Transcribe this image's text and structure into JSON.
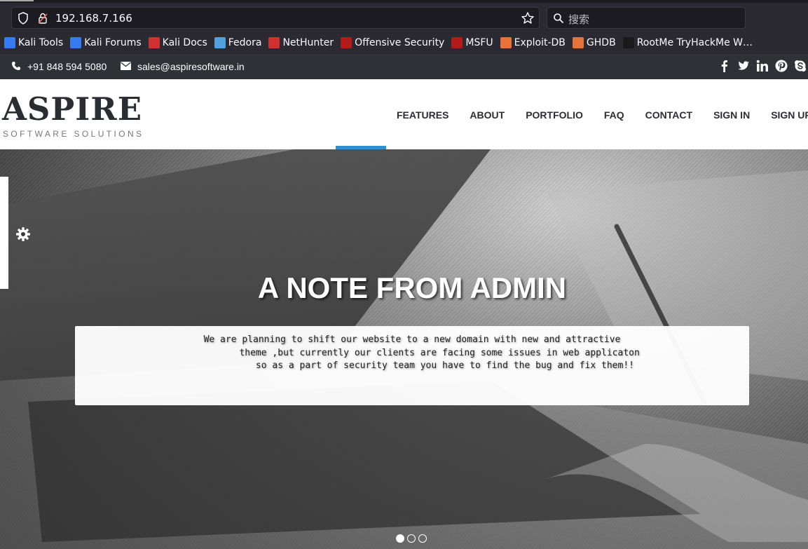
{
  "browser": {
    "url": "192.168.7.166",
    "search_placeholder": "搜索",
    "bookmarks": [
      {
        "label": "Kali Tools",
        "color": "#367bf0"
      },
      {
        "label": "Kali Forums",
        "color": "#367bf0"
      },
      {
        "label": "Kali Docs",
        "color": "#d0302f"
      },
      {
        "label": "Fedora",
        "color": "#51a2da"
      },
      {
        "label": "NetHunter",
        "color": "#d0302f"
      },
      {
        "label": "Offensive Security",
        "color": "#b31b1b"
      },
      {
        "label": "MSFU",
        "color": "#b31b1b"
      },
      {
        "label": "Exploit-DB",
        "color": "#e8733a"
      },
      {
        "label": "GHDB",
        "color": "#e8733a"
      },
      {
        "label": "RootMe TryHackMe W…",
        "color": "#1a1a1a"
      }
    ]
  },
  "topbar": {
    "phone": "+91 848 594 5080",
    "email": "sales@aspiresoftware.in",
    "social_icons": [
      "facebook-icon",
      "twitter-icon",
      "linkedin-icon",
      "pinterest-icon",
      "skype-icon"
    ]
  },
  "site": {
    "logo": "ASPIRE",
    "tagline": "SOFTWARE SOLUTIONS",
    "accent_color": "#2e8fd1",
    "nav": [
      "FEATURES",
      "ABOUT",
      "PORTFOLIO",
      "FAQ",
      "CONTACT",
      "SIGN IN",
      "SIGN UP"
    ]
  },
  "hero": {
    "title": "A NOTE FROM ADMIN",
    "note": "We are planning to shift our website to a new domain with new and attractive\n          theme ,but currently our clients are facing some issues in web applicaton\n            so as a part of security team you have to find the bug and fix them!!",
    "slide_count": 3,
    "active_slide": 1
  }
}
